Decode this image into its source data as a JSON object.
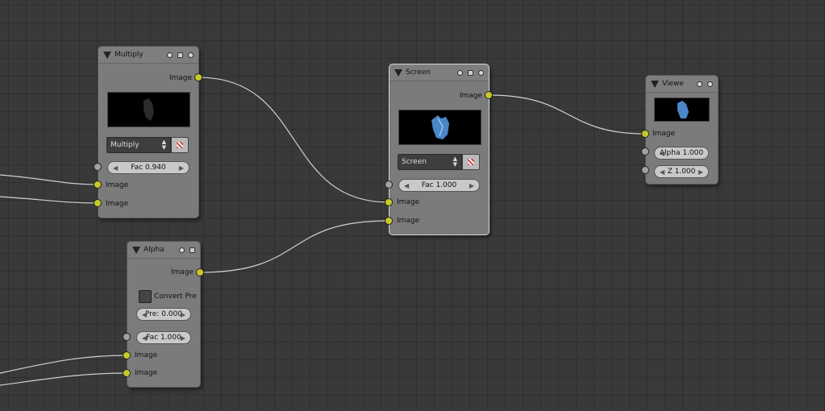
{
  "nodes": {
    "multiply": {
      "title": "Multiply",
      "output_label": "Image",
      "blend_mode": "Multiply",
      "fac": "Fac 0.940",
      "input1_label": "Image",
      "input2_label": "Image"
    },
    "screen": {
      "title": "Screen",
      "output_label": "Image",
      "blend_mode": "Screen",
      "fac": "Fac 1.000",
      "input1_label": "Image",
      "input2_label": "Image"
    },
    "viewer": {
      "title": "Viewe",
      "input_label": "Image",
      "alpha": "Alpha 1.000",
      "z": "Z 1.000"
    },
    "alpha": {
      "title": "Alpha",
      "output_label": "Image",
      "convert_label": "Convert Pre",
      "pre": "Pre: 0.000",
      "fac": "Fac 1.000",
      "input1_label": "Image",
      "input2_label": "Image"
    }
  },
  "colors": {
    "background": "#393939",
    "grid": "#2f2f2f",
    "node_body": "#7b7b7b",
    "image_socket": "#c8c82a",
    "value_socket": "#a1a1a1",
    "link": "#d0d0d0"
  }
}
